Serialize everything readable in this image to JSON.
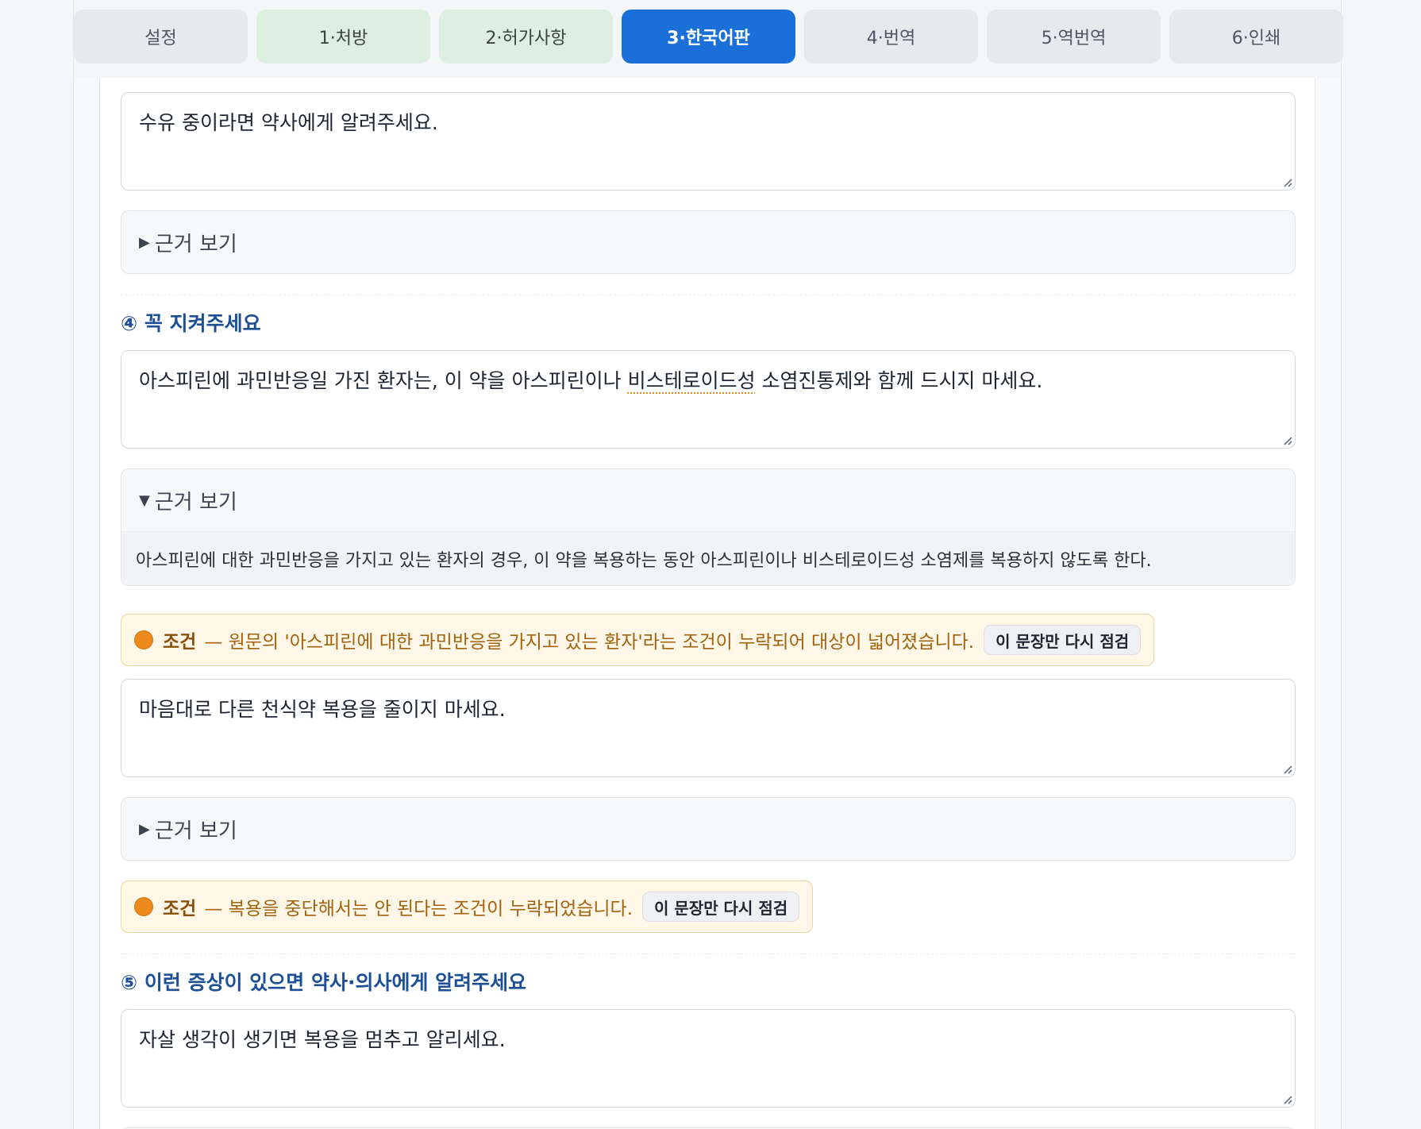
{
  "tabs": [
    {
      "label": "설정",
      "state": "default"
    },
    {
      "label": "1·처방",
      "state": "done"
    },
    {
      "label": "2·허가사항",
      "state": "done"
    },
    {
      "label": "3·한국어판",
      "state": "active"
    },
    {
      "label": "4·번역",
      "state": "default"
    },
    {
      "label": "5·역번역",
      "state": "default"
    },
    {
      "label": "6·인쇄",
      "state": "default"
    }
  ],
  "block1": {
    "text": "수유 중이라면 약사에게 알려주세요.",
    "evidence_toggle": "근거 보기",
    "evidence_open": false
  },
  "section4": {
    "title": "④ 꼭 지켜주세요",
    "item1": {
      "text_before": "아스피린에 과민반응일 가진 환자는, 이 약을 아스피린이나 ",
      "text_flagged": "비스테로이드성",
      "text_after": " 소염진통제와 함께 드시지 마세요.",
      "evidence_toggle": "근거 보기",
      "evidence_open": true,
      "evidence_text": "아스피린에 대한 과민반응을 가지고 있는 환자의 경우, 이 약을 복용하는 동안 아스피린이나 비스테로이드성 소염제를 복용하지 않도록 한다.",
      "warning": {
        "label": "조건",
        "message": "— 원문의 '아스피린에 대한 과민반응을 가지고 있는 환자'라는 조건이 누락되어 대상이 넓어졌습니다.",
        "button": "이 문장만 다시 점검",
        "color": "#ec8a1c"
      }
    },
    "item2": {
      "text": "마음대로 다른 천식약 복용을 줄이지 마세요.",
      "evidence_toggle": "근거 보기",
      "evidence_open": false,
      "warning": {
        "label": "조건",
        "message": "— 복용을 중단해서는 안 된다는 조건이 누락되었습니다.",
        "button": "이 문장만 다시 점검",
        "color": "#ec8a1c"
      }
    }
  },
  "section5": {
    "title": "⑤ 이런 증상이 있으면 약사·의사에게 알려주세요",
    "item1": {
      "text": "자살 생각이 생기면 복용을 멈추고 알리세요."
    }
  },
  "colors": {
    "accent": "#1a6fd8",
    "done_tab": "#dcefe1",
    "section_title": "#1d4f96",
    "warning_bg": "#fff7e8"
  }
}
